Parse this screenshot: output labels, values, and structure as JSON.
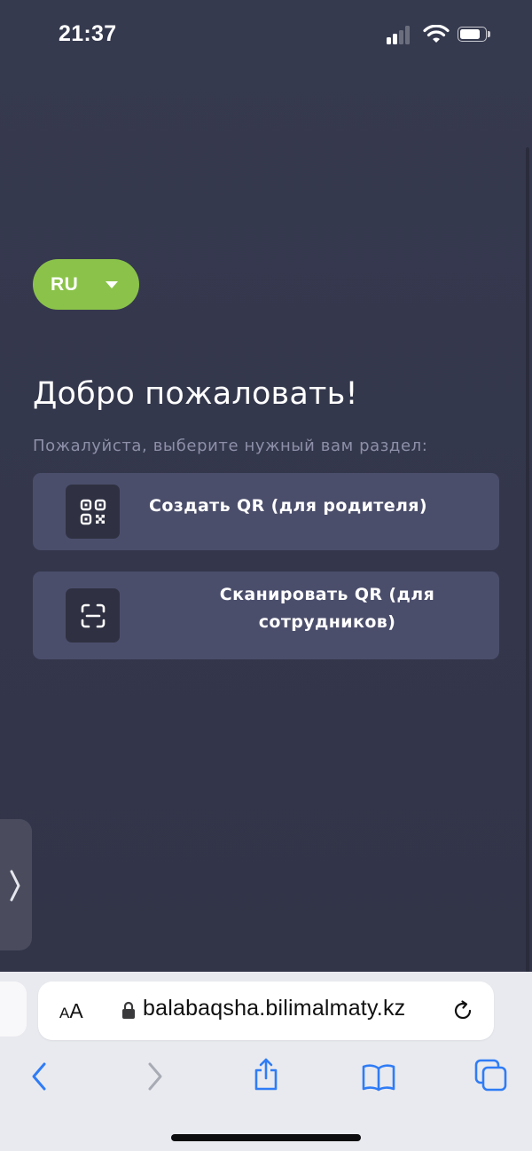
{
  "status_bar": {
    "time": "21:37",
    "signal_icon": "cellular-signal-icon",
    "wifi_icon": "wifi-icon",
    "battery_icon": "battery-icon"
  },
  "language": {
    "current": "RU",
    "icon": "caret-down-icon",
    "accent_color": "#8bc34a"
  },
  "welcome": {
    "title": "Добро пожаловать!",
    "subtitle": "Пожалуйста, выберите нужный вам раздел:"
  },
  "options": [
    {
      "label": "Создать QR (для родителя)",
      "icon": "qr-code-icon"
    },
    {
      "label": "Сканировать QR (для сотрудников)",
      "icon": "scan-icon"
    }
  ],
  "side_tab": {
    "icon": "chevron-right-icon"
  },
  "browser": {
    "text_size_label_small": "A",
    "text_size_label_large": "A",
    "lock_icon": "lock-icon",
    "url": "balabaqsha.bilimalmaty.kz",
    "reload_icon": "reload-icon",
    "toolbar": [
      "back-icon",
      "forward-icon",
      "share-icon",
      "bookmarks-icon",
      "tabs-icon"
    ]
  },
  "colors": {
    "background": "#353749",
    "card": "#4b4e6b",
    "icon_box": "#2f3142",
    "subtitle": "#8d90a8"
  }
}
